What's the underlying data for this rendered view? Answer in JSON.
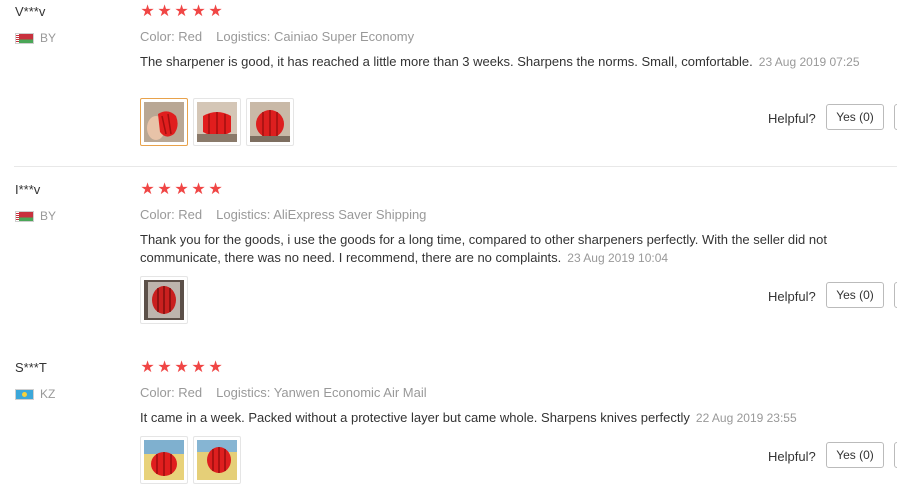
{
  "reviews": [
    {
      "user": "V***v",
      "country": "BY",
      "rating": 5,
      "color": "Color: Red",
      "logistics": "Logistics: Cainiao Super Economy",
      "text": "The sharpener is good, it has reached a little more than 3 weeks. Sharpens the norms. Small, comfortable.",
      "date": "23 Aug 2019 07:25",
      "photos": 3,
      "helpful_label": "Helpful?",
      "yes_label": "Yes (0)"
    },
    {
      "user": "I***v",
      "country": "BY",
      "rating": 5,
      "color": "Color: Red",
      "logistics": "Logistics: AliExpress Saver Shipping",
      "text": "Thank you for the goods, i use the goods for a long time, compared to other sharpeners perfectly. With the seller did not communicate, there was no need. I recommend, there are no complaints.",
      "date": "23 Aug 2019 10:04",
      "photos": 1,
      "helpful_label": "Helpful?",
      "yes_label": "Yes (0)"
    },
    {
      "user": "S***T",
      "country": "KZ",
      "rating": 5,
      "color": "Color: Red",
      "logistics": "Logistics: Yanwen Economic Air Mail",
      "text": "It came in a week. Packed without a protective layer but came whole. Sharpens knives perfectly",
      "date": "22 Aug 2019 23:55",
      "photos": 2,
      "helpful_label": "Helpful?",
      "yes_label": "Yes (0)"
    }
  ],
  "icons": {
    "star": "star-icon",
    "flag_by": "belarus-flag-icon",
    "flag_kz": "kazakhstan-flag-icon"
  },
  "colors": {
    "star": "#f04645",
    "meta": "#999999",
    "text": "#333333"
  }
}
